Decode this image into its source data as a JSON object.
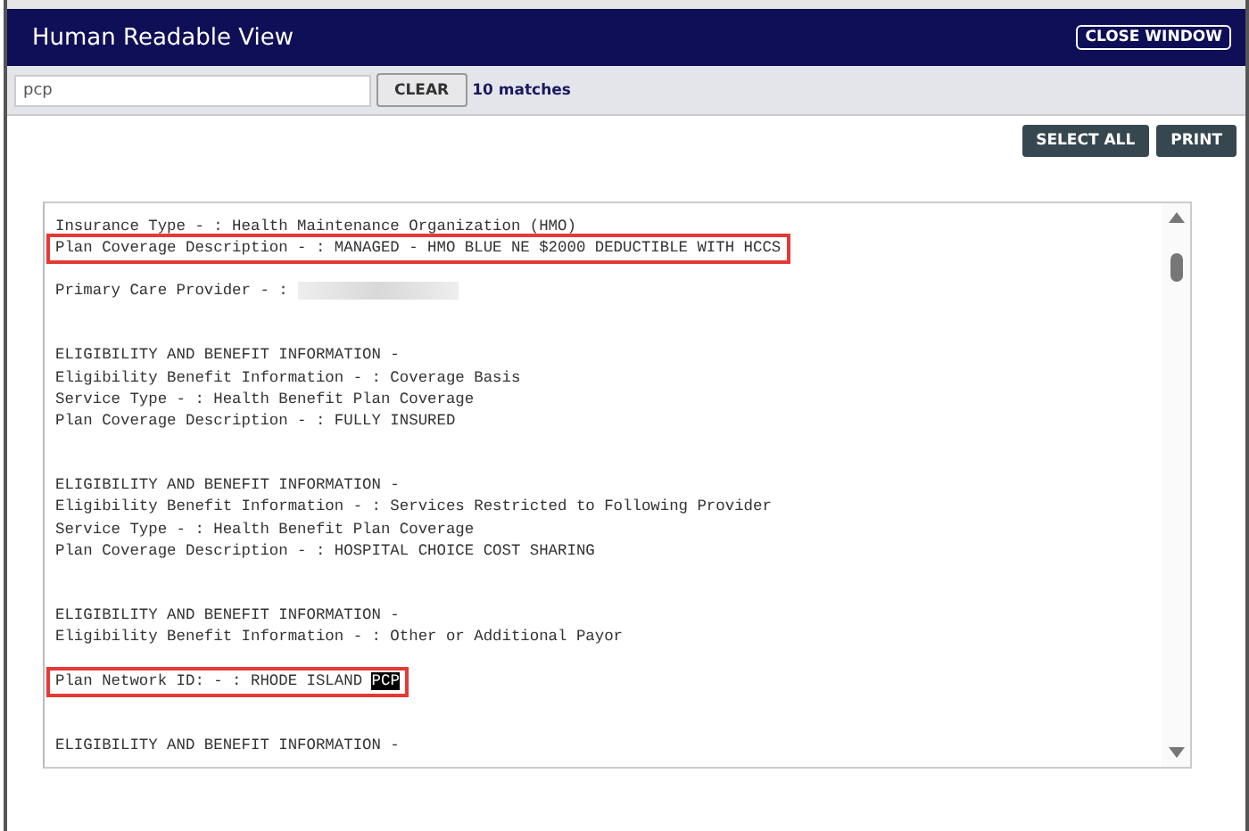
{
  "window": {
    "title": "Human Readable View",
    "close_button": "CLOSE WINDOW"
  },
  "search": {
    "value": "pcp",
    "clear_button": "CLEAR",
    "matches": "10 matches"
  },
  "actions": [
    "SELECT ALL",
    "PRINT"
  ],
  "document": {
    "lines": [
      {
        "kind": "text",
        "text": "Insurance Type - : Health Maintenance Organization (HMO)",
        "outlined": false
      },
      {
        "kind": "text",
        "text": "Plan Coverage Description - : MANAGED - HMO BLUE NE $2000 DEDUCTIBLE WITH HCCS",
        "outlined": true
      },
      {
        "kind": "blank"
      },
      {
        "kind": "redacted",
        "text": "Primary Care Provider - :",
        "outlined": false
      },
      {
        "kind": "blank"
      },
      {
        "kind": "blank"
      },
      {
        "kind": "text",
        "text": "ELIGIBILITY AND BENEFIT INFORMATION -",
        "outlined": false
      },
      {
        "kind": "text",
        "text": "Eligibility Benefit Information - : Coverage Basis",
        "outlined": false
      },
      {
        "kind": "text",
        "text": "Service Type - : Health Benefit Plan Coverage",
        "outlined": false
      },
      {
        "kind": "text",
        "text": "Plan Coverage Description - : FULLY INSURED",
        "outlined": false
      },
      {
        "kind": "blank"
      },
      {
        "kind": "blank"
      },
      {
        "kind": "text",
        "text": "ELIGIBILITY AND BENEFIT INFORMATION -",
        "outlined": false
      },
      {
        "kind": "text",
        "text": "Eligibility Benefit Information - : Services Restricted to Following Provider",
        "outlined": false
      },
      {
        "kind": "text",
        "text": "Service Type - : Health Benefit Plan Coverage",
        "outlined": false
      },
      {
        "kind": "text",
        "text": "Plan Coverage Description - : HOSPITAL CHOICE COST SHARING",
        "outlined": false
      },
      {
        "kind": "blank"
      },
      {
        "kind": "blank"
      },
      {
        "kind": "text",
        "text": "ELIGIBILITY AND BENEFIT INFORMATION -",
        "outlined": false
      },
      {
        "kind": "text",
        "text": "Eligibility Benefit Information - : Other or Additional Payor",
        "outlined": false
      },
      {
        "kind": "blank"
      },
      {
        "kind": "match",
        "text": "Plan Network ID: - : RHODE ISLAND",
        "match": "PCP",
        "outlined": true
      },
      {
        "kind": "blank"
      },
      {
        "kind": "blank"
      },
      {
        "kind": "text",
        "text": "ELIGIBILITY AND BENEFIT INFORMATION -",
        "outlined": false
      }
    ]
  }
}
